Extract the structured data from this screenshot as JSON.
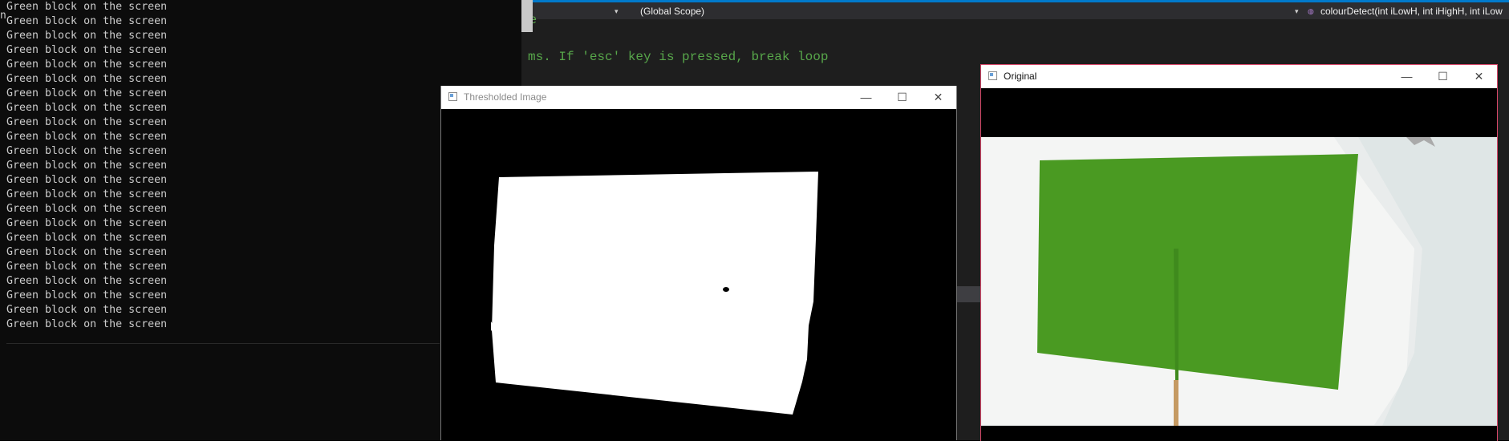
{
  "console": {
    "lines": [
      "Green block on the screen",
      "Green block on the screen",
      "Green block on the screen",
      "Green block on the screen",
      "Green block on the screen",
      "Green block on the screen",
      "Green block on the screen",
      "Green block on the screen",
      "Green block on the screen",
      "Green block on the screen",
      "Green block on the screen",
      "Green block on the screen",
      "Green block on the screen",
      "Green block on the screen",
      "Green block on the screen",
      "Green block on the screen",
      "Green block on the screen",
      "Green block on the screen",
      "Green block on the screen",
      "Green block on the screen",
      "Green block on the screen",
      "Green block on the screen",
      "Green block on the screen"
    ],
    "left_glyph": "n"
  },
  "ide": {
    "nav": {
      "scope": "(Global Scope)",
      "member": "colourDetect(int iLowH, int iHighH, int iLow"
    },
    "code_lines": [
      "ge",
      "ms. If 'esc' key is pressed, break loop"
    ],
    "accent_color": "#007acc"
  },
  "windows": {
    "thresholded": {
      "title": "Thresholded Image",
      "buttons": {
        "minimize": "—",
        "maximize": "☐",
        "close": "✕"
      }
    },
    "original": {
      "title": "Original",
      "buttons": {
        "minimize": "—",
        "maximize": "☐",
        "close": "✕"
      },
      "border_color": "#d9486a"
    }
  },
  "colors": {
    "green_block": "#4a9a22",
    "code_comment": "#57a64a"
  }
}
